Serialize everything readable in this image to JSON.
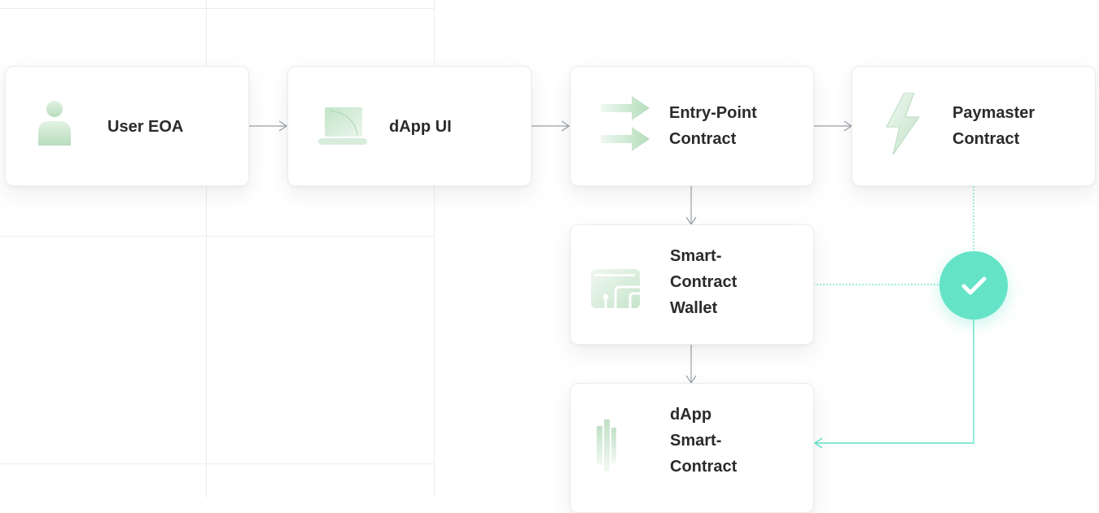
{
  "nodes": {
    "user_eoa": {
      "label": "User EOA",
      "icon": "user-icon"
    },
    "dapp_ui": {
      "label": "dApp UI",
      "icon": "laptop-icon"
    },
    "entry_point": {
      "label": "Entry-Point\nContract",
      "icon": "double-arrow-icon"
    },
    "paymaster": {
      "label": "Paymaster\nContract",
      "icon": "lightning-icon"
    },
    "smart_wallet": {
      "label": "Smart-\nContract\nWallet",
      "icon": "wallet-icon"
    },
    "dapp_contract": {
      "label": "dApp\nSmart-\nContract",
      "icon": "bars-icon"
    }
  },
  "edges": [
    {
      "from": "user_eoa",
      "to": "dapp_ui"
    },
    {
      "from": "dapp_ui",
      "to": "entry_point"
    },
    {
      "from": "entry_point",
      "to": "paymaster"
    },
    {
      "from": "entry_point",
      "to": "smart_wallet"
    },
    {
      "from": "smart_wallet",
      "to": "dapp_contract"
    },
    {
      "from": "paymaster",
      "to": "dapp_contract"
    }
  ],
  "validation_badge": {
    "icon": "check-icon"
  },
  "colors": {
    "accent_teal": "#64e3c7",
    "connector_gray": "#9aa1aa",
    "icon_green": "#cfe9d3",
    "text": "#2b2b2b"
  }
}
